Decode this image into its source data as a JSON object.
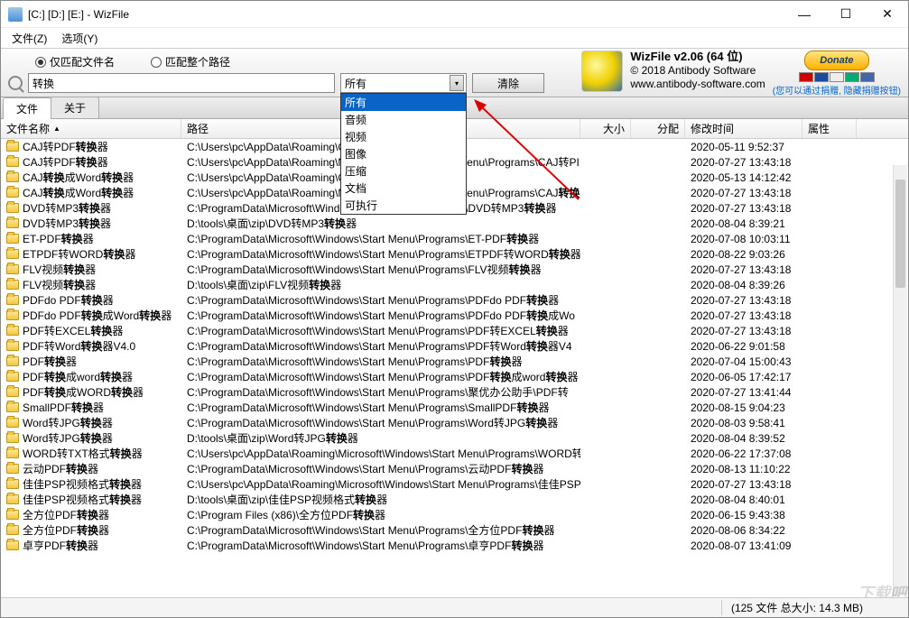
{
  "window": {
    "title": "[C:] [D:] [E:]  -  WizFile"
  },
  "menu": {
    "file": "文件(Z)",
    "options": "选项(Y)"
  },
  "toolbar": {
    "radio_name_only": "仅匹配文件名",
    "radio_full_path": "匹配整个路径",
    "search_value": "转换",
    "filter_selected": "所有",
    "clear": "清除",
    "dropdown": [
      "所有",
      "音频",
      "视频",
      "图像",
      "压缩",
      "文档",
      "可执行"
    ]
  },
  "brand": {
    "title": "WizFile v2.06 (64 位)",
    "copyright": "© 2018 Antibody Software",
    "url": "www.antibody-software.com",
    "donate": "Donate",
    "donate_note": "(您可以通过捐赠, 隐藏捐赠按钮)"
  },
  "tabs": {
    "file": "文件",
    "about": "关于"
  },
  "columns": {
    "name": "文件名称",
    "path": "路径",
    "size": "大小",
    "alloc": "分配",
    "mod": "修改时间",
    "attr": "属性"
  },
  "status": "(125 文件  总大小: 14.3 MB)",
  "hl": "转换",
  "rows": [
    {
      "n": "CAJ转PDF转换器",
      "p": "C:\\Users\\pc\\AppData\\Roaming\\CAJ转",
      "m": "2020-05-11 9:52:37"
    },
    {
      "n": "CAJ转PDF转换器",
      "p": "C:\\Users\\pc\\AppData\\Roaming\\Microsoft\\Windows\\Start Menu\\Programs\\CAJ转PI",
      "m": "2020-07-27 13:43:18"
    },
    {
      "n": "CAJ转换成Word转换器",
      "p": "C:\\Users\\pc\\AppData\\Roaming\\CAJ转换",
      "m": "2020-05-13 14:12:42"
    },
    {
      "n": "CAJ转换成Word转换器",
      "p": "C:\\Users\\pc\\AppData\\Roaming\\Microsoft\\Windows\\Start Menu\\Programs\\CAJ转换",
      "m": "2020-07-27 13:43:18"
    },
    {
      "n": "DVD转MP3转换器",
      "p": "C:\\ProgramData\\Microsoft\\Windows\\Start Menu\\Programs\\DVD转MP3转换器",
      "m": "2020-07-27 13:43:18"
    },
    {
      "n": "DVD转MP3转换器",
      "p": "D:\\tools\\桌面\\zip\\DVD转MP3转换器",
      "m": "2020-08-04 8:39:21"
    },
    {
      "n": "ET-PDF转换器",
      "p": "C:\\ProgramData\\Microsoft\\Windows\\Start Menu\\Programs\\ET-PDF转换器",
      "m": "2020-07-08 10:03:11"
    },
    {
      "n": "ETPDF转WORD转换器",
      "p": "C:\\ProgramData\\Microsoft\\Windows\\Start Menu\\Programs\\ETPDF转WORD转换器",
      "m": "2020-08-22 9:03:26"
    },
    {
      "n": "FLV视频转换器",
      "p": "C:\\ProgramData\\Microsoft\\Windows\\Start Menu\\Programs\\FLV视频转换器",
      "m": "2020-07-27 13:43:18"
    },
    {
      "n": "FLV视频转换器",
      "p": "D:\\tools\\桌面\\zip\\FLV视频转换器",
      "m": "2020-08-04 8:39:26"
    },
    {
      "n": "PDFdo PDF转换器",
      "p": "C:\\ProgramData\\Microsoft\\Windows\\Start Menu\\Programs\\PDFdo PDF转换器",
      "m": "2020-07-27 13:43:18"
    },
    {
      "n": "PDFdo PDF转换成Word转换器",
      "p": "C:\\ProgramData\\Microsoft\\Windows\\Start Menu\\Programs\\PDFdo PDF转换成Wo",
      "m": "2020-07-27 13:43:18"
    },
    {
      "n": "PDF转EXCEL转换器",
      "p": "C:\\ProgramData\\Microsoft\\Windows\\Start Menu\\Programs\\PDF转EXCEL转换器",
      "m": "2020-07-27 13:43:18"
    },
    {
      "n": "PDF转Word转换器V4.0",
      "p": "C:\\ProgramData\\Microsoft\\Windows\\Start Menu\\Programs\\PDF转Word转换器V4",
      "m": "2020-06-22 9:01:58"
    },
    {
      "n": "PDF转换器",
      "p": "C:\\ProgramData\\Microsoft\\Windows\\Start Menu\\Programs\\PDF转换器",
      "m": "2020-07-04 15:00:43"
    },
    {
      "n": "PDF转换成word转换器",
      "p": "C:\\ProgramData\\Microsoft\\Windows\\Start Menu\\Programs\\PDF转换成word转换器",
      "m": "2020-06-05 17:42:17"
    },
    {
      "n": "PDF转换成WORD转换器",
      "p": "C:\\ProgramData\\Microsoft\\Windows\\Start Menu\\Programs\\聚优办公助手\\PDF转",
      "m": "2020-07-27 13:41:44"
    },
    {
      "n": "SmallPDF转换器",
      "p": "C:\\ProgramData\\Microsoft\\Windows\\Start Menu\\Programs\\SmallPDF转换器",
      "m": "2020-08-15 9:04:23"
    },
    {
      "n": "Word转JPG转换器",
      "p": "C:\\ProgramData\\Microsoft\\Windows\\Start Menu\\Programs\\Word转JPG转换器",
      "m": "2020-08-03 9:58:41"
    },
    {
      "n": "Word转JPG转换器",
      "p": "D:\\tools\\桌面\\zip\\Word转JPG转换器",
      "m": "2020-08-04 8:39:52"
    },
    {
      "n": "WORD转TXT格式转换器",
      "p": "C:\\Users\\pc\\AppData\\Roaming\\Microsoft\\Windows\\Start Menu\\Programs\\WORD转",
      "m": "2020-06-22 17:37:08"
    },
    {
      "n": "云动PDF转换器",
      "p": "C:\\ProgramData\\Microsoft\\Windows\\Start Menu\\Programs\\云动PDF转换器",
      "m": "2020-08-13 11:10:22"
    },
    {
      "n": "佳佳PSP视频格式转换器",
      "p": "C:\\Users\\pc\\AppData\\Roaming\\Microsoft\\Windows\\Start Menu\\Programs\\佳佳PSP",
      "m": "2020-07-27 13:43:18"
    },
    {
      "n": "佳佳PSP视频格式转换器",
      "p": "D:\\tools\\桌面\\zip\\佳佳PSP视频格式转换器",
      "m": "2020-08-04 8:40:01"
    },
    {
      "n": "全方位PDF转换器",
      "p": "C:\\Program Files (x86)\\全方位PDF转换器",
      "m": "2020-06-15 9:43:38"
    },
    {
      "n": "全方位PDF转换器",
      "p": "C:\\ProgramData\\Microsoft\\Windows\\Start Menu\\Programs\\全方位PDF转换器",
      "m": "2020-08-06 8:34:22"
    },
    {
      "n": "卓亨PDF转换器",
      "p": "C:\\ProgramData\\Microsoft\\Windows\\Start Menu\\Programs\\卓亨PDF转换器",
      "m": "2020-08-07 13:41:09"
    }
  ]
}
